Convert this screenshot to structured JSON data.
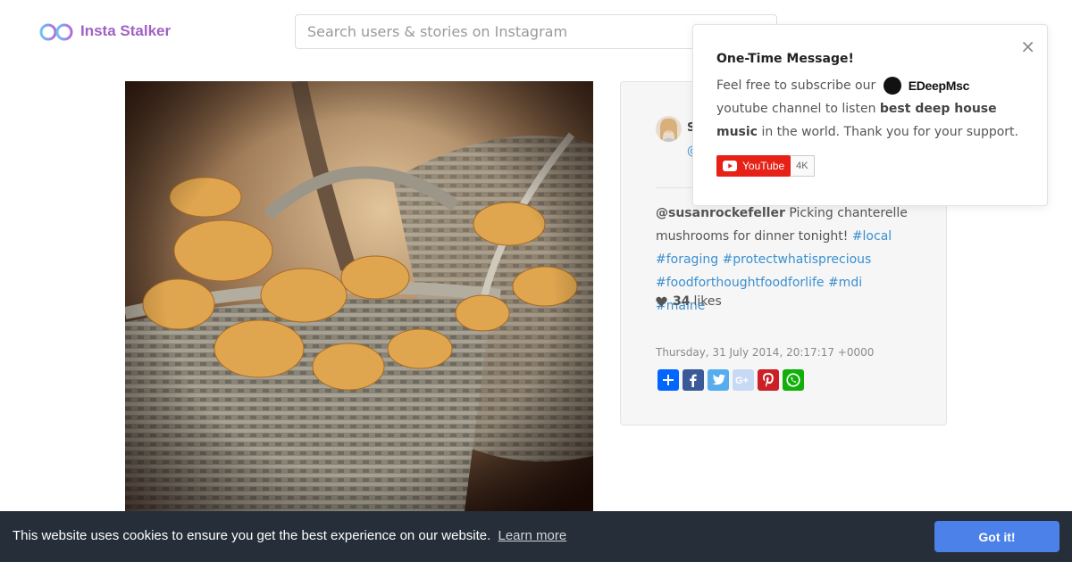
{
  "header": {
    "logo_text": "Insta Stalker",
    "search_placeholder": "Search users & stories on Instagram"
  },
  "post": {
    "image_alt": "Chanterelle mushrooms in woven baskets",
    "author_name": "S",
    "author_handle": "@",
    "caption_user": "@susanrockefeller",
    "caption_text": " Picking chanterelle mushrooms for dinner tonight! ",
    "hashtags": [
      "#local",
      "#foraging",
      "#protectwhatisprecious",
      "#foodforthoughtfoodforlife",
      "#mdi",
      "#maine"
    ],
    "likes_count": "34",
    "likes_label": "likes",
    "date": "Thursday, 31 July 2014, 20:17:17 +0000",
    "share_buttons": [
      {
        "name": "share-icon",
        "color": "#0166ff"
      },
      {
        "name": "facebook-icon",
        "color": "#3b5998"
      },
      {
        "name": "twitter-icon",
        "color": "#55acee"
      },
      {
        "name": "google-plus-icon",
        "color": "#c7d9f5"
      },
      {
        "name": "pinterest-icon",
        "color": "#cb2027"
      },
      {
        "name": "whatsapp-icon",
        "color": "#12af0a"
      }
    ]
  },
  "popup": {
    "close": "×",
    "title": "One-Time Message!",
    "body_1": "Feel free to subscribe our",
    "channel_name": "EDeepMsc",
    "body_2": "youtube channel to listen",
    "body_bold": "best deep house music",
    "body_3": "in the world. Thank you for your support.",
    "youtube_label": "YouTube",
    "youtube_count": "4K"
  },
  "cookie": {
    "message": "This website uses cookies to ensure you get the best experience on our website.",
    "link": "Learn more",
    "button": "Got it!"
  },
  "colors": {
    "accent_purple": "#a062c4",
    "link_blue": "#3a8fd0",
    "cookie_bg": "#252e39",
    "cookie_button": "#4b81e8"
  }
}
